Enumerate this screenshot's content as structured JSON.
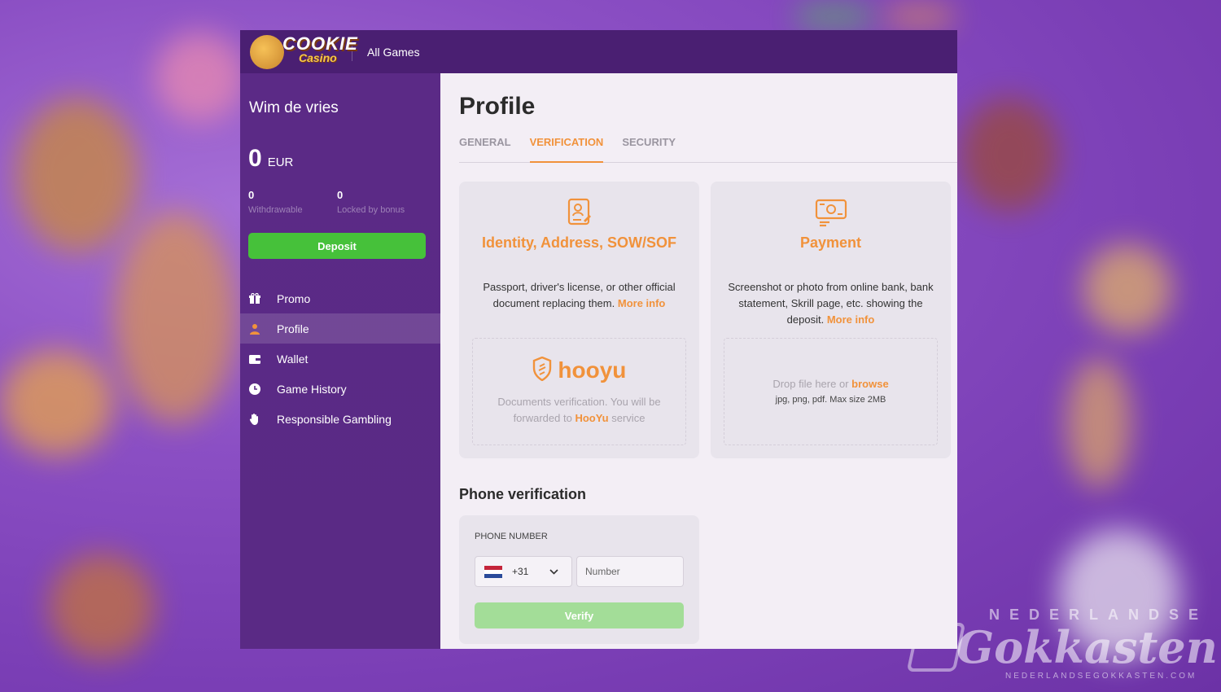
{
  "header": {
    "logo_text": "COOKIE",
    "logo_sub": "Casino",
    "all_games": "All Games"
  },
  "sidebar": {
    "user_name": "Wim de vries",
    "balance": {
      "amount": "0",
      "currency": "EUR"
    },
    "withdrawable": {
      "value": "0",
      "label": "Withdrawable"
    },
    "locked": {
      "value": "0",
      "label": "Locked by bonus"
    },
    "deposit_label": "Deposit",
    "items": [
      {
        "label": "Promo",
        "icon": "gift-icon"
      },
      {
        "label": "Profile",
        "icon": "user-icon",
        "active": true
      },
      {
        "label": "Wallet",
        "icon": "wallet-icon"
      },
      {
        "label": "Game History",
        "icon": "clock-icon"
      },
      {
        "label": "Responsible Gambling",
        "icon": "hand-icon"
      }
    ]
  },
  "main": {
    "title": "Profile",
    "tabs": [
      {
        "label": "GENERAL"
      },
      {
        "label": "VERIFICATION",
        "active": true
      },
      {
        "label": "SECURITY"
      }
    ],
    "identity_card": {
      "title": "Identity, Address, SOW/SOF",
      "desc": "Passport, driver's license, or other official document replacing them.",
      "more": "More info",
      "hooyu_logo": "hooyu",
      "hooyu_desc_1": "Documents verification. You will be forwarded to",
      "hooyu_link": "HooYu",
      "hooyu_desc_2": "service"
    },
    "payment_card": {
      "title": "Payment",
      "desc": "Screenshot or photo from online bank, bank statement, Skrill page, etc. showing the deposit.",
      "more": "More info",
      "drop_text": "Drop file here or",
      "browse": "browse",
      "drop_sub": "jpg, png, pdf. Max size 2MB"
    },
    "phone": {
      "title": "Phone verification",
      "label": "PHONE NUMBER",
      "dial_code": "+31",
      "number_placeholder": "Number",
      "verify_label": "Verify"
    }
  },
  "watermark": {
    "top": "NEDERLANDSE",
    "main": "Gokkasten",
    "bottom": "NEDERLANDSEGOKKASTEN.COM"
  },
  "colors": {
    "accent": "#f1923b",
    "sidebar": "#5b2a86",
    "topbar": "#4a1f72",
    "deposit": "#46c13a",
    "verify": "#a3dd98"
  }
}
